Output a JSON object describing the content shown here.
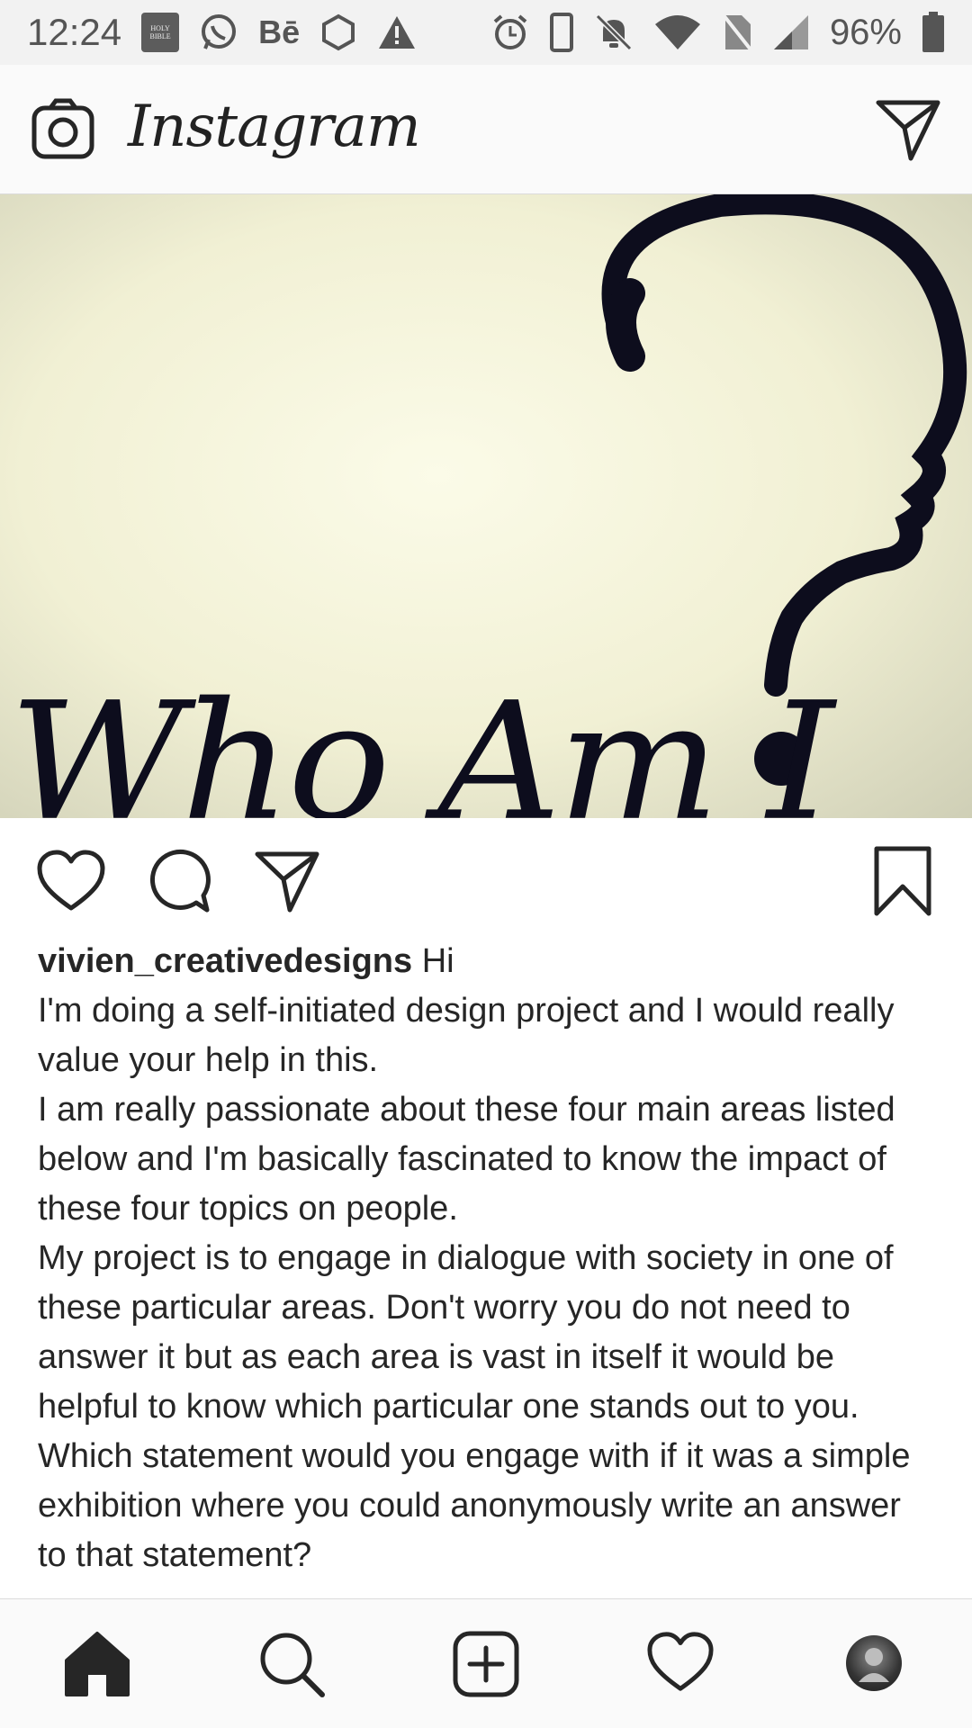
{
  "status_bar": {
    "time": "12:24",
    "battery_percent": "96%",
    "bible_icon_text": "HOLY BIBLE",
    "behance_label": "Bē",
    "icons_left": [
      "bible-app-icon",
      "whatsapp-icon",
      "behance-icon",
      "hexagon-icon",
      "warning-icon"
    ],
    "icons_right": [
      "alarm-icon",
      "phone-icon",
      "mute-icon",
      "wifi-icon",
      "no-sim-icon",
      "signal-icon",
      "battery-icon"
    ]
  },
  "header": {
    "logo_text": "Instagram"
  },
  "post": {
    "image_text": "Who Am I",
    "username": "vivien_creativedesigns",
    "caption_lines": [
      " Hi",
      "I'm doing a self-initiated design project and I would really value your help in this.",
      "I am really passionate about these four main areas listed below and I'm basically fascinated to know the impact of these four topics on people.",
      "My project is to engage in dialogue with society in one of these particular areas. Don't worry you do not need to answer it but as each area is vast in itself it would be helpful to know which particular one stands out to you. Which statement would you engage with if it was a simple exhibition where you could anonymously write an answer to that statement?"
    ]
  },
  "colors": {
    "text": "#262626",
    "header_bg": "#fafafa",
    "status_bg": "#f2f2f2",
    "art_ink": "#0d0d1d"
  }
}
